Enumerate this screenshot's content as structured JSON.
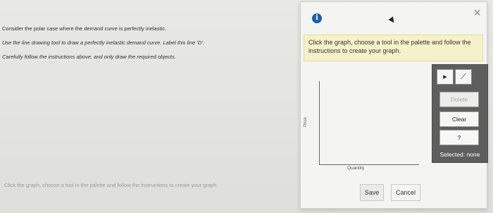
{
  "instructions": {
    "line1": "Consider the polar case where the demand curve is perfectly inelastic.",
    "line2": "Use the line drawing tool to draw a perfectly inelastic demand curve. Label this line 'D'.",
    "line3": "Carefully follow the instructions above, and only draw the required objects."
  },
  "footer_hint": "Click the graph, choose a tool in the palette and follow the instructions to create your graph.",
  "dialog": {
    "info_icon": "i",
    "close_icon": "×",
    "banner": "Click the graph, choose a tool in the palette and follow the instructions to create your graph.",
    "graph": {
      "y_label": "Price",
      "x_label": "Quantity"
    },
    "palette": {
      "arrow_tool_icon": "▸",
      "line_tool_icon": "⟋",
      "delete_label": "Delete",
      "clear_label": "Clear",
      "help_label": "?",
      "selected_text": "Selected: none"
    },
    "save_label": "Save",
    "cancel_label": "Cancel"
  }
}
